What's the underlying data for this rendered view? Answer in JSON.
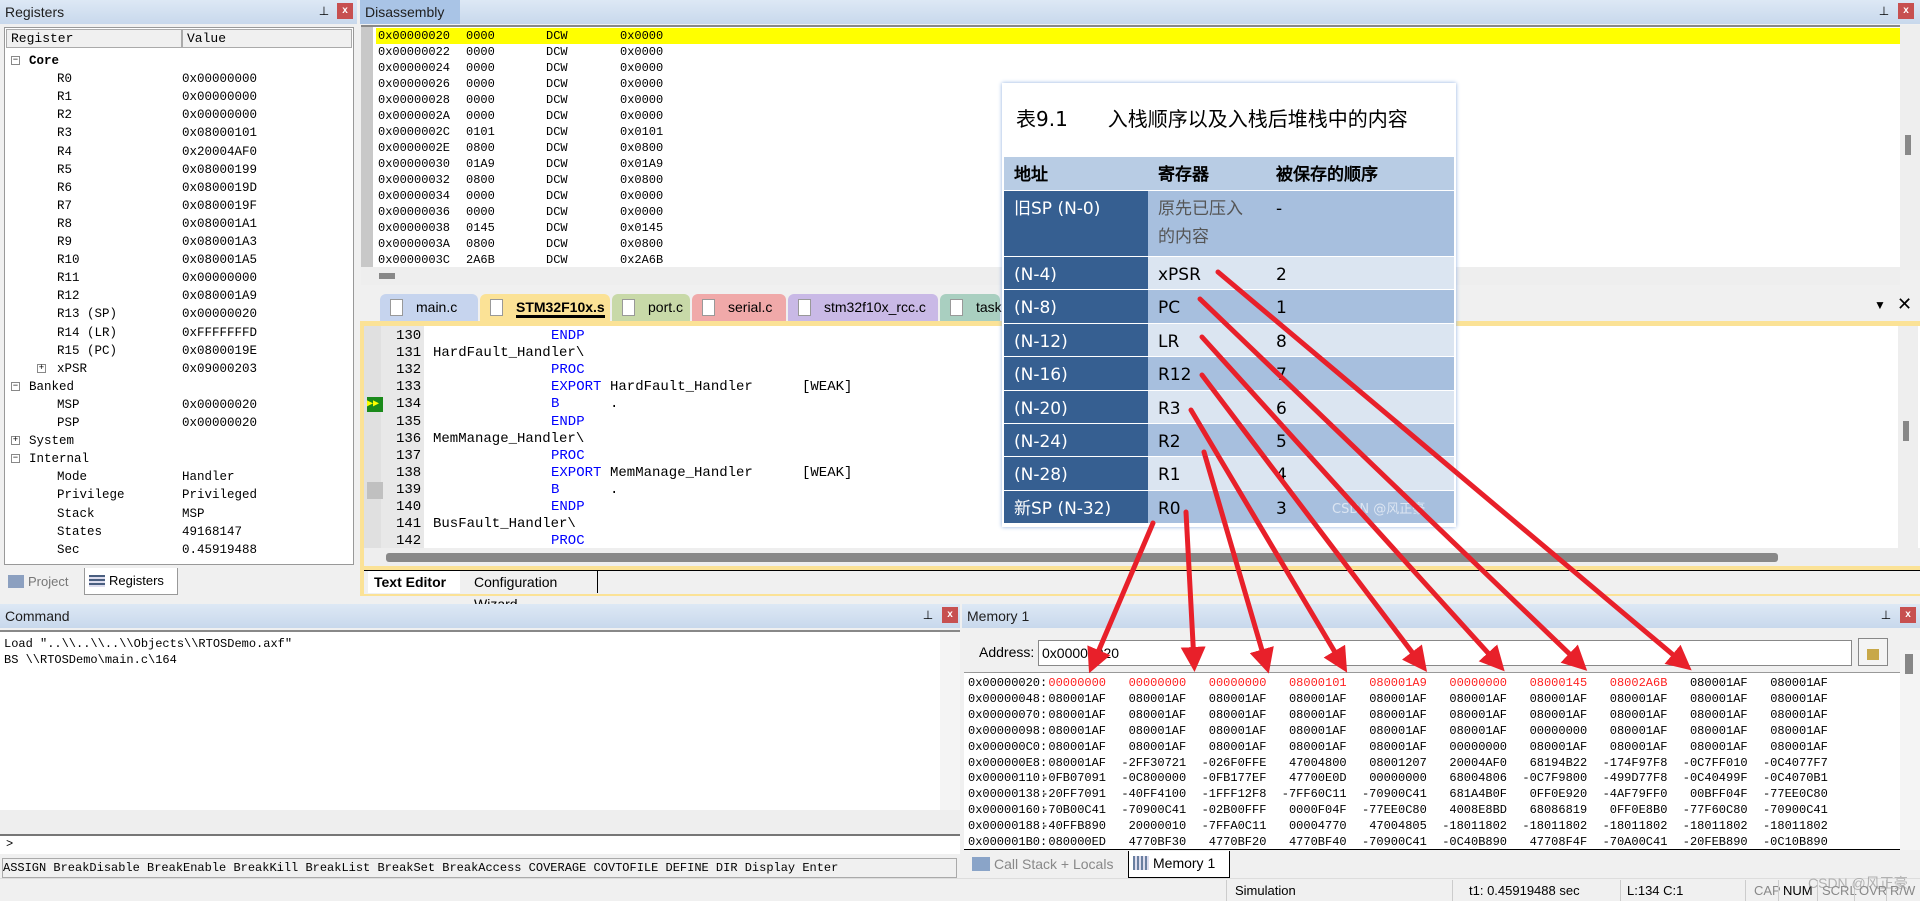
{
  "registers": {
    "title": "Registers",
    "col_register": "Register",
    "col_value": "Value",
    "rows": [
      {
        "name": "Core",
        "value": "",
        "level": 0,
        "expander": "minus",
        "bold": true
      },
      {
        "name": "R0",
        "value": "0x00000000",
        "level": 1
      },
      {
        "name": "R1",
        "value": "0x00000000",
        "level": 1
      },
      {
        "name": "R2",
        "value": "0x00000000",
        "level": 1
      },
      {
        "name": "R3",
        "value": "0x08000101",
        "level": 1
      },
      {
        "name": "R4",
        "value": "0x20004AF0",
        "level": 1
      },
      {
        "name": "R5",
        "value": "0x08000199",
        "level": 1
      },
      {
        "name": "R6",
        "value": "0x0800019D",
        "level": 1
      },
      {
        "name": "R7",
        "value": "0x0800019F",
        "level": 1
      },
      {
        "name": "R8",
        "value": "0x080001A1",
        "level": 1
      },
      {
        "name": "R9",
        "value": "0x080001A3",
        "level": 1
      },
      {
        "name": "R10",
        "value": "0x080001A5",
        "level": 1
      },
      {
        "name": "R11",
        "value": "0x00000000",
        "level": 1
      },
      {
        "name": "R12",
        "value": "0x080001A9",
        "level": 1
      },
      {
        "name": "R13 (SP)",
        "value": "0x00000020",
        "level": 1
      },
      {
        "name": "R14 (LR)",
        "value": "0xFFFFFFFD",
        "level": 1
      },
      {
        "name": "R15 (PC)",
        "value": "0x0800019E",
        "level": 1
      },
      {
        "name": "xPSR",
        "value": "0x09000203",
        "level": 1,
        "expander": "plus"
      },
      {
        "name": "Banked",
        "value": "",
        "level": 0,
        "expander": "minus"
      },
      {
        "name": "MSP",
        "value": "0x00000020",
        "level": 1
      },
      {
        "name": "PSP",
        "value": "0x00000020",
        "level": 1
      },
      {
        "name": "System",
        "value": "",
        "level": 0,
        "expander": "plus"
      },
      {
        "name": "Internal",
        "value": "",
        "level": 0,
        "expander": "minus"
      },
      {
        "name": "Mode",
        "value": "Handler",
        "level": 1
      },
      {
        "name": "Privilege",
        "value": "Privileged",
        "level": 1
      },
      {
        "name": "Stack",
        "value": "MSP",
        "level": 1
      },
      {
        "name": "States",
        "value": "49168147",
        "level": 1
      },
      {
        "name": "Sec",
        "value": "0.45919488",
        "level": 1
      }
    ],
    "tabs": [
      {
        "label": "Project",
        "active": false
      },
      {
        "label": "Registers",
        "active": true
      }
    ]
  },
  "disassembly": {
    "title": "Disassembly",
    "rows": [
      [
        "0x00000020",
        "0000",
        "DCW",
        "0x0000"
      ],
      [
        "0x00000022",
        "0000",
        "DCW",
        "0x0000"
      ],
      [
        "0x00000024",
        "0000",
        "DCW",
        "0x0000"
      ],
      [
        "0x00000026",
        "0000",
        "DCW",
        "0x0000"
      ],
      [
        "0x00000028",
        "0000",
        "DCW",
        "0x0000"
      ],
      [
        "0x0000002A",
        "0000",
        "DCW",
        "0x0000"
      ],
      [
        "0x0000002C",
        "0101",
        "DCW",
        "0x0101"
      ],
      [
        "0x0000002E",
        "0800",
        "DCW",
        "0x0800"
      ],
      [
        "0x00000030",
        "01A9",
        "DCW",
        "0x01A9"
      ],
      [
        "0x00000032",
        "0800",
        "DCW",
        "0x0800"
      ],
      [
        "0x00000034",
        "0000",
        "DCW",
        "0x0000"
      ],
      [
        "0x00000036",
        "0000",
        "DCW",
        "0x0000"
      ],
      [
        "0x00000038",
        "0145",
        "DCW",
        "0x0145"
      ],
      [
        "0x0000003A",
        "0800",
        "DCW",
        "0x0800"
      ],
      [
        "0x0000003C",
        "2A6B",
        "DCW",
        "0x2A6B"
      ]
    ],
    "highlight_color": "#ffff00"
  },
  "editor": {
    "tabs": [
      {
        "label": "main.c",
        "color": "#c6d4ee"
      },
      {
        "label": "STM32F10x.s",
        "color": "#fbe296",
        "active": true
      },
      {
        "label": "port.c",
        "color": "#c8d9a8"
      },
      {
        "label": "serial.c",
        "color": "#f0a9a9"
      },
      {
        "label": "stm32f10x_rcc.c",
        "color": "#c9b9e6"
      },
      {
        "label": "tasks",
        "color": "#a9cfc0"
      }
    ],
    "lines": [
      {
        "num": "130",
        "label": "",
        "op": "ENDP",
        "arg": "",
        "attr": ""
      },
      {
        "num": "131",
        "label": "HardFault_Handler\\",
        "op": "",
        "arg": "",
        "attr": ""
      },
      {
        "num": "132",
        "label": "",
        "op": "PROC",
        "arg": "",
        "attr": ""
      },
      {
        "num": "133",
        "label": "",
        "op": "EXPORT",
        "arg": "HardFault_Handler",
        "attr": "[WEAK]"
      },
      {
        "num": "134",
        "label": "",
        "op": "B",
        "arg": ".",
        "attr": "",
        "current": true
      },
      {
        "num": "135",
        "label": "",
        "op": "ENDP",
        "arg": "",
        "attr": ""
      },
      {
        "num": "136",
        "label": "MemManage_Handler\\",
        "op": "",
        "arg": "",
        "attr": ""
      },
      {
        "num": "137",
        "label": "",
        "op": "PROC",
        "arg": "",
        "attr": ""
      },
      {
        "num": "138",
        "label": "",
        "op": "EXPORT",
        "arg": "MemManage_Handler",
        "attr": "[WEAK]"
      },
      {
        "num": "139",
        "label": "",
        "op": "B",
        "arg": ".",
        "attr": ""
      },
      {
        "num": "140",
        "label": "",
        "op": "ENDP",
        "arg": "",
        "attr": ""
      },
      {
        "num": "141",
        "label": "BusFault_Handler\\",
        "op": "",
        "arg": "",
        "attr": ""
      },
      {
        "num": "142",
        "label": "",
        "op": "PROC",
        "arg": "",
        "attr": ""
      }
    ],
    "bottom_tabs": [
      "Text Editor",
      "Configuration Wizard"
    ]
  },
  "command": {
    "title": "Command",
    "output": [
      "Load \"..\\\\..\\\\..\\\\Objects\\\\RTOSDemo.axf\"",
      "BS \\\\RTOSDemo\\main.c\\164"
    ],
    "prompt": ">",
    "hints": "ASSIGN BreakDisable BreakEnable BreakKill BreakList BreakSet BreakAccess COVERAGE COVTOFILE DEFINE DIR Display Enter"
  },
  "memory": {
    "title": "Memory 1",
    "address_label": "Address:",
    "address_value": "0x00000020",
    "rows": [
      {
        "addr": "0x00000020:",
        "vals": [
          "00000000",
          "00000000",
          "00000000",
          "08000101",
          "080001A9",
          "00000000",
          "08000145",
          "08002A6B",
          "080001AF",
          "080001AF"
        ],
        "red_count": 8
      },
      {
        "addr": "0x00000048:",
        "vals": [
          "080001AF",
          "080001AF",
          "080001AF",
          "080001AF",
          "080001AF",
          "080001AF",
          "080001AF",
          "080001AF",
          "080001AF",
          "080001AF"
        ]
      },
      {
        "addr": "0x00000070:",
        "vals": [
          "080001AF",
          "080001AF",
          "080001AF",
          "080001AF",
          "080001AF",
          "080001AF",
          "080001AF",
          "080001AF",
          "080001AF",
          "080001AF"
        ]
      },
      {
        "addr": "0x00000098:",
        "vals": [
          "080001AF",
          "080001AF",
          "080001AF",
          "080001AF",
          "080001AF",
          "080001AF",
          "00000000",
          "080001AF",
          "080001AF",
          "080001AF"
        ]
      },
      {
        "addr": "0x000000C0:",
        "vals": [
          "080001AF",
          "080001AF",
          "080001AF",
          "080001AF",
          "080001AF",
          "00000000",
          "080001AF",
          "080001AF",
          "080001AF",
          "080001AF"
        ]
      },
      {
        "addr": "0x000000E8:",
        "vals": [
          "080001AF",
          "-2FF30721",
          "-026F0FFE",
          "47004800",
          "08001207",
          "20004AF0",
          "68194B22",
          "-174F97F8",
          "-0C7FF010",
          "-0C4077F7"
        ]
      },
      {
        "addr": "0x00000110:",
        "vals": [
          "-0FB07091",
          "-0C800000",
          "-0FB177EF",
          "47700E0D",
          "00000000",
          "68004806",
          "-0C7F9800",
          "-499D77F8",
          "-0C40499F",
          "-0C4070B1"
        ]
      },
      {
        "addr": "0x00000138:",
        "vals": [
          "-20FF7091",
          "-40FF4100",
          "-1FFF12F8",
          "-7FF60C11",
          "-70900C41",
          "681A4B0F",
          "0FF0E920",
          "-4AF79FF0",
          "00BFF04F",
          "-77EE0C80"
        ]
      },
      {
        "addr": "0x00000160:",
        "vals": [
          "-70B00C41",
          "-70900C41",
          "-02B00FFF",
          "0000F04F",
          "-77EE0C80",
          "4008E8BD",
          "68086819",
          "0FF0E8B0",
          "-77F60C80",
          "-70900C41"
        ]
      },
      {
        "addr": "0x00000188:",
        "vals": [
          "-40FFB890",
          "20000010",
          "-7FFA0C11",
          "00004770",
          "47004805",
          "-18011802",
          "-18011802",
          "-18011802",
          "-18011802",
          "-18011802"
        ]
      },
      {
        "addr": "0x000001B0:",
        "vals": [
          "080000ED",
          "4770BF30",
          "4770BF20",
          "4770BF40",
          "-70900C41",
          "-0C40B890",
          "47708F4F",
          "-70A00C41",
          "-20FEB890",
          "-0C10B890"
        ]
      }
    ],
    "tabs": [
      {
        "label": "Call Stack + Locals",
        "active": false
      },
      {
        "label": "Memory 1",
        "active": true
      }
    ]
  },
  "overlay_table": {
    "title": "表9.1　　入栈顺序以及入栈后堆栈中的内容",
    "headers": [
      "地址",
      "寄存器",
      "被保存的顺序"
    ],
    "rows": [
      [
        "旧SP (N-0)",
        "原先已压入的内容",
        "-"
      ],
      [
        "(N-4)",
        "xPSR",
        "2"
      ],
      [
        "(N-8)",
        "PC",
        "1"
      ],
      [
        "(N-12)",
        "LR",
        "8"
      ],
      [
        "(N-16)",
        "R12",
        "7"
      ],
      [
        "(N-20)",
        "R3",
        "6"
      ],
      [
        "(N-24)",
        "R2",
        "5"
      ],
      [
        "(N-28)",
        "R1",
        "4"
      ],
      [
        "新SP (N-32)",
        "R0",
        "3"
      ]
    ],
    "watermark": "CSDN @风正豪",
    "arrow_color": "#e8202a"
  },
  "status": {
    "mode": "Simulation",
    "time": "t1: 0.45919488 sec",
    "position": "L:134 C:1",
    "cap": "CAP",
    "num": "NUM",
    "scrl": "SCRL",
    "ovr": "OVR",
    "rw": "R/W",
    "watermark": "CSDN @风正豪"
  }
}
